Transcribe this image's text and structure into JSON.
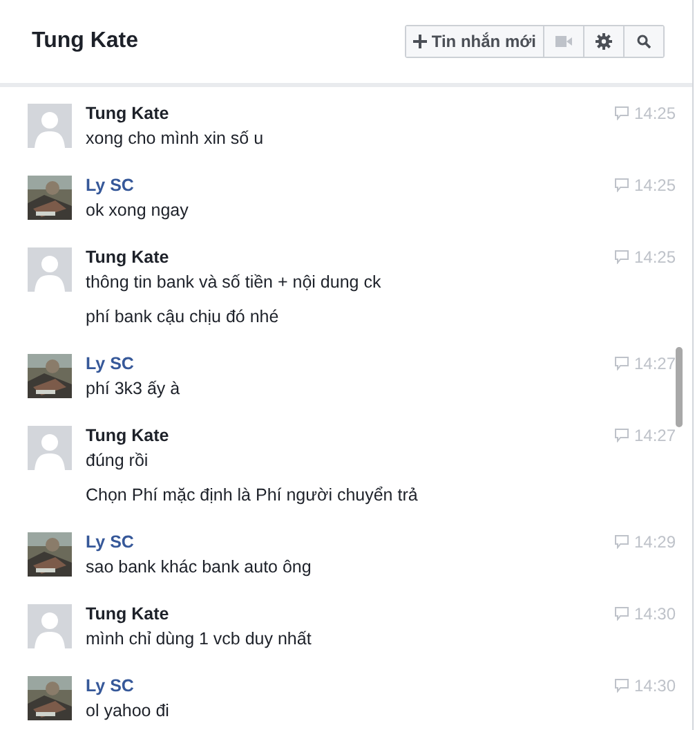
{
  "header": {
    "title": "Tung Kate",
    "new_message_button": "Tin nhắn mới"
  },
  "messages": [
    {
      "sender": "Tung Kate",
      "avatar": {
        "kind": "default"
      },
      "color": "#1d2129",
      "time": "14:25",
      "lines": [
        "xong cho mình xin số u"
      ]
    },
    {
      "sender": "Ly SC",
      "avatar": {
        "kind": "picture"
      },
      "color": "#365899",
      "time": "14:25",
      "lines": [
        "ok xong ngay"
      ]
    },
    {
      "sender": "Tung Kate",
      "avatar": {
        "kind": "default"
      },
      "color": "#1d2129",
      "time": "14:25",
      "lines": [
        "thông tin bank và số tiền + nội dung ck",
        "phí bank cậu chịu đó nhé"
      ]
    },
    {
      "sender": "Ly SC",
      "avatar": {
        "kind": "picture"
      },
      "color": "#365899",
      "time": "14:27",
      "lines": [
        "phí 3k3 ấy à"
      ]
    },
    {
      "sender": "Tung Kate",
      "avatar": {
        "kind": "default"
      },
      "color": "#1d2129",
      "time": "14:27",
      "lines": [
        "đúng rồi",
        "Chọn Phí mặc định là Phí người chuyển trả"
      ]
    },
    {
      "sender": "Ly SC",
      "avatar": {
        "kind": "picture"
      },
      "color": "#365899",
      "time": "14:29",
      "lines": [
        "sao bank khác bank auto ông"
      ]
    },
    {
      "sender": "Tung Kate",
      "avatar": {
        "kind": "default"
      },
      "color": "#1d2129",
      "time": "14:30",
      "lines": [
        "mình chỉ dùng 1 vcb duy nhất"
      ]
    },
    {
      "sender": "Ly SC",
      "avatar": {
        "kind": "picture"
      },
      "color": "#365899",
      "time": "14:30",
      "lines": [
        "ol yahoo đi"
      ]
    }
  ]
}
